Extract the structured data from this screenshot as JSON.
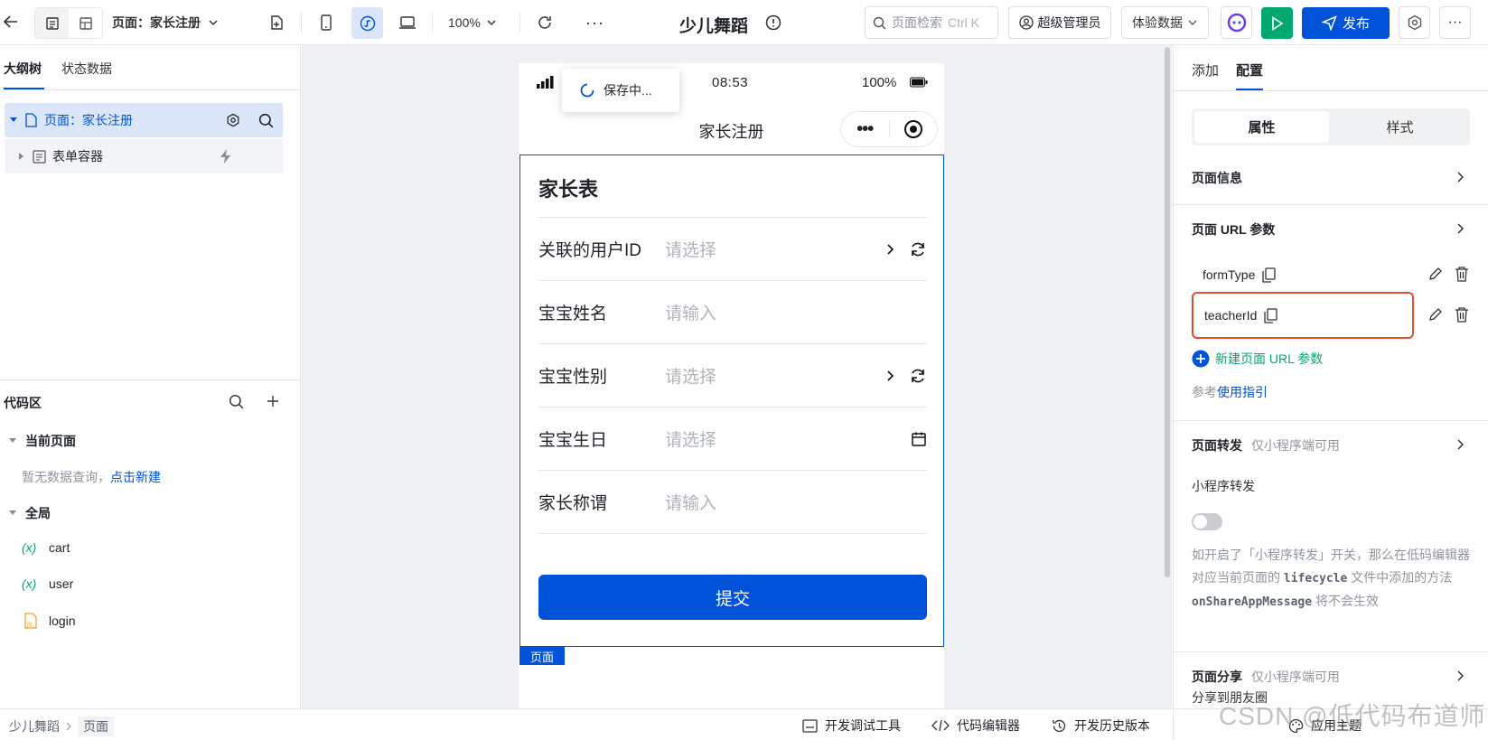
{
  "topbar": {
    "page_selector": "页面：家长注册",
    "zoom": "100%",
    "app_title": "少儿舞蹈",
    "search_placeholder": "页面检索",
    "search_shortcut": "Ctrl K",
    "admin": "超级管理员",
    "data_env": "体验数据",
    "publish": "发布"
  },
  "left": {
    "tabs": [
      "大纲树",
      "状态数据"
    ],
    "tree": [
      {
        "label": "页面：家长注册"
      },
      {
        "label": "表单容器"
      }
    ],
    "code_title": "代码区",
    "current_page": "当前页面",
    "empty_text": "暂无数据查询，",
    "empty_link": "点击新建",
    "global": "全局",
    "vars": [
      {
        "icon": "(x)",
        "name": "cart"
      },
      {
        "icon": "(x)",
        "name": "user"
      },
      {
        "icon": "JS",
        "name": "login"
      }
    ]
  },
  "phone": {
    "time": "08:53",
    "battery": "100%",
    "nav_title": "家长注册",
    "saving": "保存中...",
    "form_title": "家长表",
    "rows": [
      {
        "label": "关联的用户ID",
        "placeholder": "请选择"
      },
      {
        "label": "宝宝姓名",
        "placeholder": "请输入"
      },
      {
        "label": "宝宝性别",
        "placeholder": "请选择"
      },
      {
        "label": "宝宝生日",
        "placeholder": "请选择"
      },
      {
        "label": "家长称谓",
        "placeholder": "请输入"
      }
    ],
    "submit": "提交",
    "page_tag": "页面"
  },
  "right": {
    "tabs": [
      "添加",
      "配置"
    ],
    "seg": [
      "属性",
      "样式"
    ],
    "page_info": "页面信息",
    "url_params": "页面 URL 参数",
    "params": [
      "formType",
      "teacherId"
    ],
    "add_param": "新建页面 URL 参数",
    "ref_prefix": "参考",
    "ref_link": "使用指引",
    "forward_title": "页面转发",
    "forward_note": "仅小程序端可用",
    "mini_forward": "小程序转发",
    "desc_1": "如开启了「小程序转发」开关，那么在低码编辑器对应当前页面的 ",
    "desc_code1": "lifecycle",
    "desc_2": " 文件中添加的方法 ",
    "desc_code2": "onShareAppMessage",
    "desc_3": " 将不会生效",
    "share_title": "页面分享",
    "share_note": "仅小程序端可用",
    "share_friends": "分享到朋友圈"
  },
  "footer": {
    "crumbs": [
      "少儿舞蹈",
      "页面"
    ],
    "debug": "开发调试工具",
    "code_editor": "代码编辑器",
    "history": "开发历史版本",
    "theme": "应用主题"
  },
  "watermark": "CSDN @低代码布道师"
}
